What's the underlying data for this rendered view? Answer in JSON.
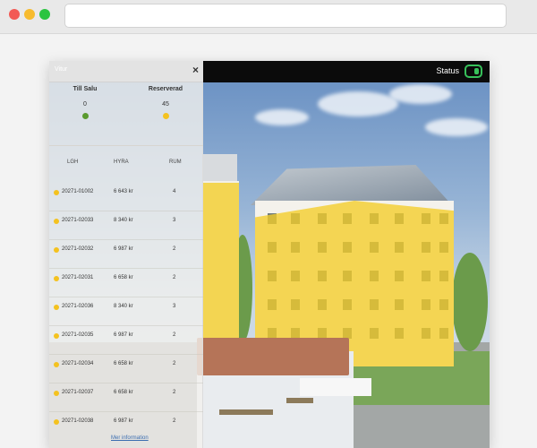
{
  "window": {
    "url": ""
  },
  "panel": {
    "title": "Vitur",
    "close_label": "×",
    "summary": [
      {
        "label": "Till Salu",
        "value": "0",
        "color": "#5a9a2f"
      },
      {
        "label": "Reserverad",
        "value": "45",
        "color": "#f4c21f"
      }
    ],
    "columns": {
      "lgh": "LGH",
      "hyra": "HYRA",
      "rum": "RUM"
    },
    "rows": [
      {
        "id": "20271-01002",
        "hyra": "6 643 kr",
        "rum": "4",
        "status_color": "#f4c21f"
      },
      {
        "id": "20271-02033",
        "hyra": "8 340 kr",
        "rum": "3",
        "status_color": "#f4c21f"
      },
      {
        "id": "20271-02032",
        "hyra": "6 987 kr",
        "rum": "2",
        "status_color": "#f4c21f"
      },
      {
        "id": "20271-02031",
        "hyra": "6 658 kr",
        "rum": "2",
        "status_color": "#f4c21f"
      },
      {
        "id": "20271-02036",
        "hyra": "8 340 kr",
        "rum": "3",
        "status_color": "#f4c21f"
      },
      {
        "id": "20271-02035",
        "hyra": "6 987 kr",
        "rum": "2",
        "status_color": "#f4c21f"
      },
      {
        "id": "20271-02034",
        "hyra": "6 658 kr",
        "rum": "2",
        "status_color": "#f4c21f"
      },
      {
        "id": "20271-02037",
        "hyra": "6 658 kr",
        "rum": "2",
        "status_color": "#f4c21f"
      },
      {
        "id": "20271-02038",
        "hyra": "6 987 kr",
        "rum": "2",
        "status_color": "#f4c21f"
      }
    ],
    "more_link": "Mer information"
  },
  "topbar": {
    "status_label": "Status",
    "status_toggle_on": true,
    "toggle_color": "#37c15a"
  },
  "colors": {
    "highlight": "#f4cd28",
    "available": "#5a9a2f",
    "reserved": "#f4c21f"
  }
}
